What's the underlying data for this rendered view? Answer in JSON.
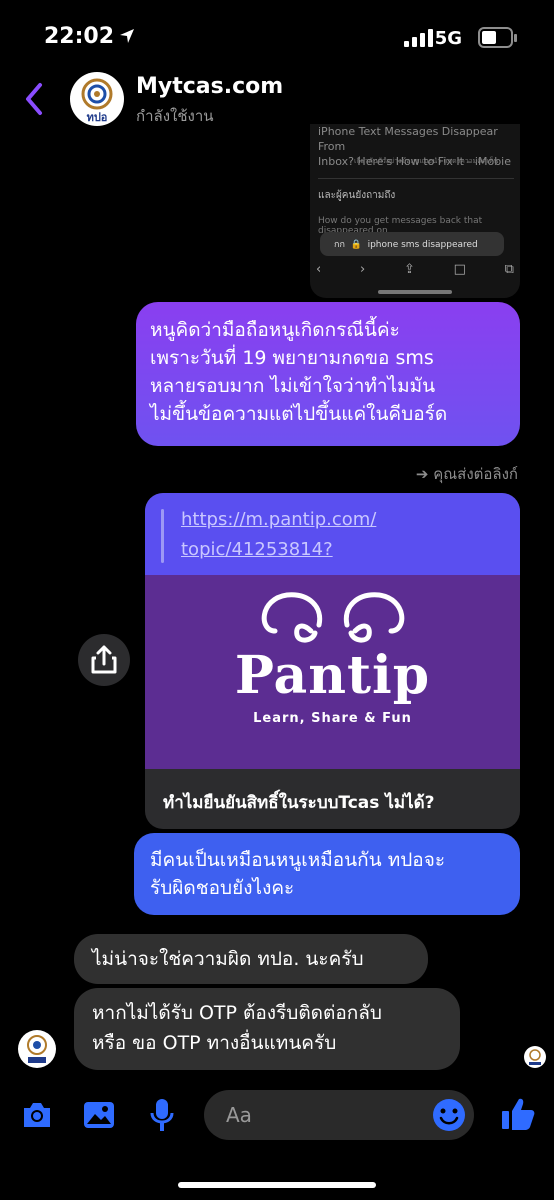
{
  "status": {
    "time": "22:02",
    "network": "5G"
  },
  "header": {
    "title": "Mytcas.com",
    "subtitle": "กำลังใช้งาน",
    "avatar_text": "ทปอ"
  },
  "shared_screenshot": {
    "headline_1": "iPhone Text Messages Disappear From",
    "headline_2": "Inbox? Here's How to Fix It - iMobie",
    "meta": "เกี่ยวกับตัวอย่างข้อมูลแนะนำ    แสดงความคิดเห็น",
    "section": "และผู้คนยังถามถึง",
    "question": "How do you get messages back that disappeared on",
    "address_prefix": "กก",
    "address": "iphone sms disappeared"
  },
  "messages": {
    "m1_lines": [
      "หนูคิดว่ามือถือหนูเกิดกรณีนี้ค่ะ",
      "เพราะวันที่ 19 พยายามกดขอ sms",
      "หลายรอบมาก ไม่เข้าใจว่าทำไมมัน",
      "ไม่ขึ้นข้อความแต่ไปขึ้นแค่ในคีบอร์ด"
    ],
    "forward_label": "คุณส่งต่อลิงก์",
    "link": {
      "url_line1": "https://m.pantip.com/",
      "url_line2": "topic/41253814?",
      "brand": "Pantip",
      "tagline": "Learn, Share & Fun",
      "title": "ทำไมยืนยันสิทธิ์ในระบบTcas ไม่ได้?"
    },
    "m2_lines": [
      "มีคนเป็นเหมือนหนูเหมือนกัน ทปอจะ",
      "รับผิดชอบยังไงคะ"
    ],
    "reply1": "ไม่น่าจะใช่ความผิด ทปอ. นะครับ",
    "reply2_lines": [
      "หากไม่ได้รับ OTP ต้องรีบติดต่อกลับ",
      "หรือ ขอ OTP ทางอื่นแทนครับ"
    ]
  },
  "composer": {
    "placeholder": "Aa"
  },
  "colors": {
    "accent": "#7b4dff",
    "outgoing_purple": "#7a46f0",
    "outgoing_blue": "#3e60f0",
    "incoming": "#303030",
    "link_img": "#5c2d92"
  },
  "icons": [
    "back-chevron-icon",
    "camera-icon",
    "image-icon",
    "mic-icon",
    "emoji-icon",
    "thumbs-up-icon",
    "share-icon"
  ]
}
